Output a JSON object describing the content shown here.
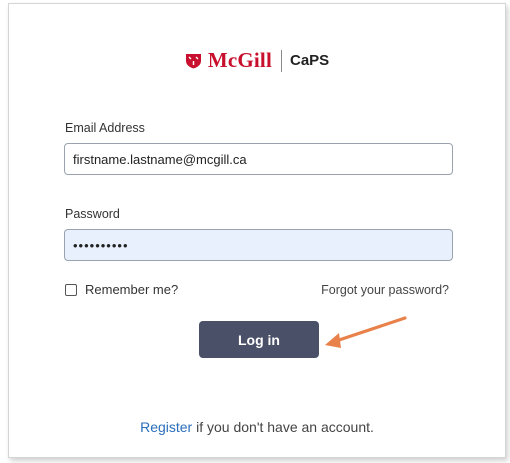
{
  "header": {
    "brand": "McGill",
    "product": "CaPS",
    "brand_color": "#c8102e",
    "shield_icon": "mcgill-shield-icon"
  },
  "form": {
    "email_label": "Email Address",
    "email_value": "firstname.lastname@mcgill.ca",
    "password_label": "Password",
    "password_value": "••••••••••",
    "remember_label": "Remember me?",
    "remember_checked": false,
    "forgot_link": "Forgot your password?",
    "login_button": "Log in",
    "login_button_color": "#4a5068",
    "autofill_color": "#e8f0fe"
  },
  "annotation": {
    "arrow_icon": "orange-pointer-arrow",
    "arrow_color": "#e8824a"
  },
  "footer": {
    "register_link": "Register",
    "register_text": " if you don't have an account."
  }
}
